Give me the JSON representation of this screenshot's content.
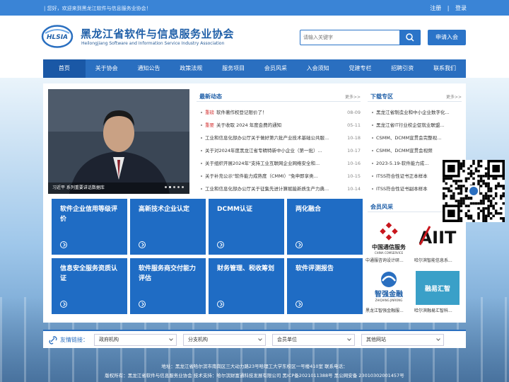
{
  "topbar": {
    "welcome": "| 您好，欢迎来到黑龙江软件与信息服务业协会！",
    "register": "注册",
    "sep": "|",
    "login": "登录"
  },
  "header": {
    "org_cn": "黑龙江省软件与信息服务业协会",
    "org_en": "Heilongjiang Software and Information Service Industry Association",
    "logo_text": "HLSIA",
    "search_placeholder": "请输入关键字",
    "join": "申请入会"
  },
  "nav": [
    "首页",
    "关于协会",
    "通知公告",
    "政策法规",
    "服务项目",
    "会员风采",
    "入会须知",
    "党建专栏",
    "招聘引资",
    "联系我们"
  ],
  "slider": {
    "caption": "习近平 系列重要讲话数据库"
  },
  "news": {
    "title": "最新动态",
    "more": "更多>>",
    "items": [
      {
        "tag": "重磅",
        "text": "软件著作权登记限价了！",
        "date": "08-09"
      },
      {
        "tag": "重要",
        "text": "关于收取 2024 年度会费的通知",
        "date": "05-11"
      },
      {
        "tag": "",
        "text": "工业和信息化部办公厅关于做好第六批产业技术基础公共服...",
        "date": "10-18"
      },
      {
        "tag": "",
        "text": "关于对2024年度黑龙江省专精特新中小企业（第一批）...",
        "date": "10-17"
      },
      {
        "tag": "",
        "text": "关于组织开展2024年\"支持工业互联网企业网络安全和...",
        "date": "10-16"
      },
      {
        "tag": "",
        "text": "关于补充公示\"软件能力成熟度（CMMI）\"免申即享类...",
        "date": "10-15"
      },
      {
        "tag": "",
        "text": "工业和信息化部办公厅关于征集先进计算赋能新质生产力典...",
        "date": "10-14"
      }
    ]
  },
  "downloads": {
    "title": "下载专区",
    "more": "更多>>",
    "items": [
      "黑龙江省制造业和中小企业数字化...",
      "黑龙江省IT行业校企促就业联盟...",
      "CSMM、DCMM宣贯会完整视...",
      "CSMM、DCMM宣贯会视频",
      "2023-5.19-软件能力成...",
      "ITSS符合性证书正本样本",
      "ITSS符合性证书副本样本"
    ]
  },
  "tiles": [
    {
      "label": "软件企业信用等级评价"
    },
    {
      "label": "高新技术企业认定"
    },
    {
      "label": "DCMM认证"
    },
    {
      "label": "两化融合"
    },
    {
      "label": "信息安全服务资质认证"
    },
    {
      "label": "软件服务商交付能力评估"
    },
    {
      "label": "财务管理、税收筹划"
    },
    {
      "label": "软件评测报告"
    }
  ],
  "members": {
    "title": "会员风采",
    "items": [
      {
        "name": "中通服咨询设计研...",
        "logo": "中国通信服务",
        "logo_en": "CHINA COMSERVICE"
      },
      {
        "name": "哈尔滨智能信息系...",
        "logo": "AIIT"
      },
      {
        "name": "黑龙江智强金融服...",
        "logo": "智强金融",
        "logo_en": "ZHIQIANG JINRONG"
      },
      {
        "name": "哈尔滨融易汇智科...",
        "logo": "融易汇智"
      }
    ]
  },
  "friendlinks": {
    "label": "友情链接：",
    "selects": [
      "政府机构",
      "分支机构",
      "会员单位",
      "其他网站"
    ]
  },
  "footer": {
    "line1": "地址：黑龙江省哈尔滨市南岗区三大动力路23号哈理工大学东校区一号楼410室      联系电话：",
    "line2": "版权所有：黑龙江省软件与信息服务业协会    技术支持：哈尔滨财富通科技发展有限公司    黑ICP备2021011388号    黑公网安备 23010302001457号"
  },
  "colors": {
    "primary": "#2a6fc0",
    "topbar": "#3a84d6",
    "tile": "#1f6cc4",
    "hot": "#d63a3a"
  }
}
